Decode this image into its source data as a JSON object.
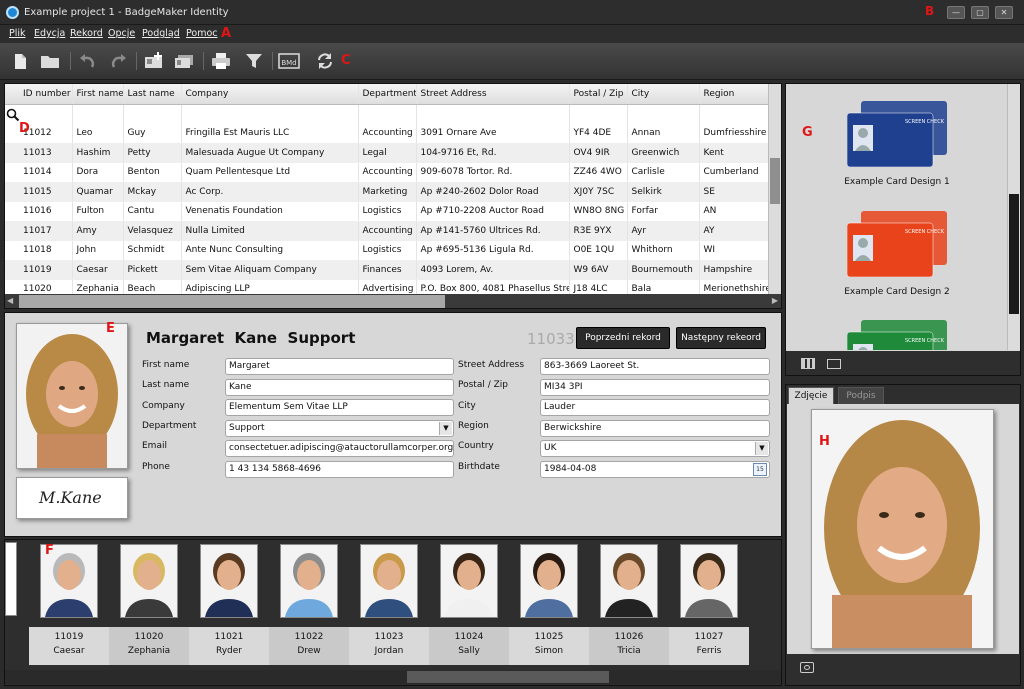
{
  "window": {
    "title": "Example project 1 - BadgeMaker Identity",
    "min": "—",
    "max": "▢",
    "close": "✕"
  },
  "markers": {
    "A": "A",
    "B": "B",
    "C": "C",
    "D": "D",
    "E": "E",
    "F": "F",
    "G": "G",
    "H": "H"
  },
  "menu": [
    "Plik",
    "Edycja",
    "Rekord",
    "Opcje",
    "Podgląd",
    "Pomoc"
  ],
  "toolbar": {
    "bmd": "BMd"
  },
  "grid": {
    "columns": [
      "ID number",
      "First name",
      "Last name",
      "Company",
      "Department",
      "Street Address",
      "Postal / Zip",
      "City",
      "Region"
    ],
    "rows": [
      [
        "11012",
        "Leo",
        "Guy",
        "Fringilla Est Mauris LLC",
        "Accounting",
        "3091 Ornare Ave",
        "YF4 4DE",
        "Annan",
        "Dumfriesshire"
      ],
      [
        "11013",
        "Hashim",
        "Petty",
        "Malesuada Augue Ut Company",
        "Legal",
        "104-9716 Et, Rd.",
        "OV4 9IR",
        "Greenwich",
        "Kent"
      ],
      [
        "11014",
        "Dora",
        "Benton",
        "Quam Pellentesque Ltd",
        "Accounting",
        "909-6078 Tortor. Rd.",
        "ZZ46 4WO",
        "Carlisle",
        "Cumberland"
      ],
      [
        "11015",
        "Quamar",
        "Mckay",
        "Ac Corp.",
        "Marketing",
        "Ap #240-2602 Dolor Road",
        "XJ0Y 7SC",
        "Selkirk",
        "SE"
      ],
      [
        "11016",
        "Fulton",
        "Cantu",
        "Venenatis Foundation",
        "Logistics",
        "Ap #710-2208 Auctor Road",
        "WN8O 8NG",
        "Forfar",
        "AN"
      ],
      [
        "11017",
        "Amy",
        "Velasquez",
        "Nulla Limited",
        "Accounting",
        "Ap #141-5760 Ultrices Rd.",
        "R3E 9YX",
        "Ayr",
        "AY"
      ],
      [
        "11018",
        "John",
        "Schmidt",
        "Ante Nunc Consulting",
        "Logistics",
        "Ap #695-5136 Ligula Rd.",
        "O0E 1QU",
        "Whithorn",
        "WI"
      ],
      [
        "11019",
        "Caesar",
        "Pickett",
        "Sem Vitae Aliquam Company",
        "Finances",
        "4093 Lorem, Av.",
        "W9 6AV",
        "Bournemouth",
        "Hampshire"
      ],
      [
        "11020",
        "Zephania",
        "Beach",
        "Adipiscing LLP",
        "Advertising",
        "P.O. Box 800, 4081 Phasellus Street",
        "J18 4LC",
        "Bala",
        "Merionethshire"
      ]
    ]
  },
  "record": {
    "name": "Margaret  Kane  Support",
    "id": "11033",
    "prev_button": "Poprzedni rekord",
    "next_button": "Następny rekeord",
    "signature": "M.Kane",
    "labels": {
      "first_name": "First name",
      "last_name": "Last name",
      "company": "Company",
      "department": "Department",
      "email": "Email",
      "phone": "Phone",
      "street": "Street Address",
      "postal": "Postal / Zip",
      "city": "City",
      "region": "Region",
      "country": "Country",
      "birthdate": "Birthdate"
    },
    "values": {
      "first_name": "Margaret",
      "last_name": "Kane",
      "company": "Elementum Sem Vitae LLP",
      "department": "Support",
      "email": "consectetuer.adipiscing@atauctorullamcorper.org",
      "phone": "1 43 134 5868-4696",
      "street": "863-3669 Laoreet St.",
      "postal": "MI34 3PI",
      "city": "Lauder",
      "region": "Berwickshire",
      "country": "UK",
      "birthdate": "1984-04-08"
    },
    "calendar_day": "15"
  },
  "thumbs": [
    {
      "id": "11019",
      "name": "Caesar",
      "hair": "#b9b9b9",
      "shirt": "#2c3e6e"
    },
    {
      "id": "11020",
      "name": "Zephania",
      "hair": "#d8b860",
      "shirt": "#3a3a3a"
    },
    {
      "id": "11021",
      "name": "Ryder",
      "hair": "#5a3b22",
      "shirt": "#1f2f55"
    },
    {
      "id": "11022",
      "name": "Drew",
      "hair": "#8d8d8d",
      "shirt": "#6fa8dc"
    },
    {
      "id": "11023",
      "name": "Jordan",
      "hair": "#c99a4a",
      "shirt": "#2f4f7f"
    },
    {
      "id": "11024",
      "name": "Sally",
      "hair": "#3a2616",
      "shirt": "#f0f0f0"
    },
    {
      "id": "11025",
      "name": "Simon",
      "hair": "#2a1c12",
      "shirt": "#4f6fa0"
    },
    {
      "id": "11026",
      "name": "Tricia",
      "hair": "#6a4a2a",
      "shirt": "#222222"
    },
    {
      "id": "11027",
      "name": "Ferris",
      "hair": "#3a2a1a",
      "shirt": "#666666"
    }
  ],
  "cards": [
    {
      "label": "Example Card Design 1",
      "color": "#1f3f8f",
      "brand": "SCREEN CHECK"
    },
    {
      "label": "Example Card Design 2",
      "color": "#e8431a",
      "brand": "SCREEN CHECK"
    }
  ],
  "third_card": {
    "color": "#1e8a3a",
    "brand": "SCREEN CHECK"
  },
  "photo_tabs": [
    "Zdjęcie",
    "Podpis"
  ],
  "colors": {
    "accent_red": "#e01515",
    "dark_bg": "#2b2b2b",
    "panel_bg": "#d7d7d7"
  }
}
